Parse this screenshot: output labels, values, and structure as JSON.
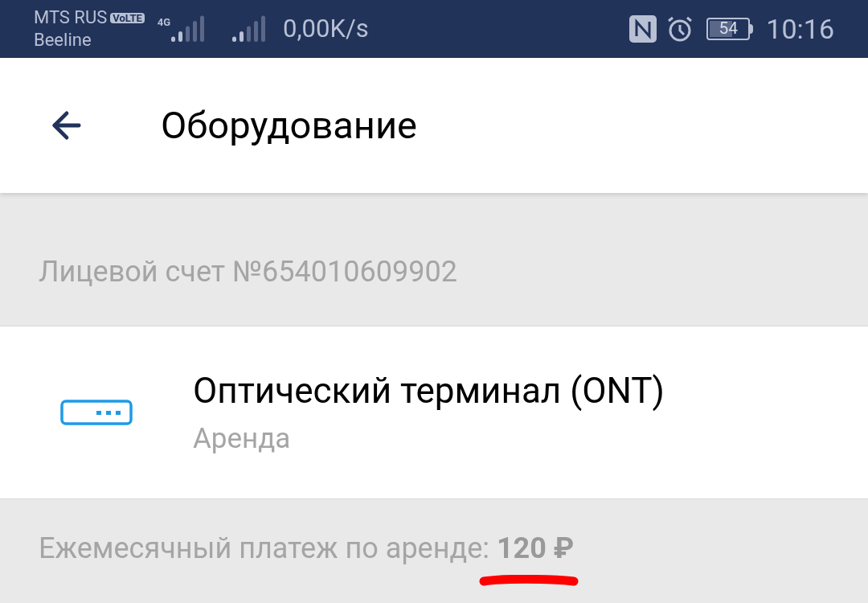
{
  "status_bar": {
    "carrier_1": "MTS RUS",
    "volte": "VoLTE",
    "carrier_2": "Beeline",
    "network": "4G",
    "speed": "0,00K/s",
    "battery": "54",
    "time": "10:16"
  },
  "header": {
    "title": "Оборудование"
  },
  "account": {
    "label": "Лицевой счет №654010609902"
  },
  "equipment": [
    {
      "name": "Оптический терминал (ONT)",
      "type": "Аренда"
    }
  ],
  "payment": {
    "text": "Ежемесячный платеж по аренде: **120 ₽**",
    "underlined": true
  }
}
